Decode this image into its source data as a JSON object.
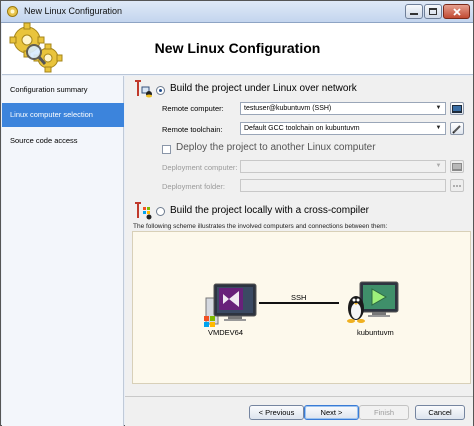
{
  "window": {
    "title": "New Linux Configuration"
  },
  "header": {
    "title": "New Linux Configuration"
  },
  "sidebar": {
    "items": [
      {
        "label": "Configuration summary",
        "selected": false
      },
      {
        "label": "Linux computer selection",
        "selected": true
      },
      {
        "label": "Source code access",
        "selected": false
      }
    ]
  },
  "main": {
    "network_option": {
      "label": "Build the project under Linux over network",
      "checked": true
    },
    "remote_computer": {
      "label": "Remote computer:",
      "value": "testuser@kubuntuvm (SSH)"
    },
    "remote_toolchain": {
      "label": "Remote toolchain:",
      "value": "Default GCC toolchain on kubuntuvm"
    },
    "deploy_option": {
      "label": "Deploy the project to another Linux computer",
      "checked": false
    },
    "deployment_computer": {
      "label": "Deployment computer:",
      "value": ""
    },
    "deployment_folder": {
      "label": "Deployment folder:",
      "value": ""
    },
    "cross_option": {
      "label": "Build the project locally with a cross-compiler",
      "checked": false
    },
    "scheme_description": "The following scheme illustrates the involved computers and connections between them:",
    "scheme": {
      "local_computer": "VMDEV64",
      "remote_computer": "kubuntuvm",
      "connection": "SSH"
    }
  },
  "footer": {
    "previous": "< Previous",
    "next": "Next >",
    "finish": "Finish",
    "cancel": "Cancel"
  },
  "colors": {
    "selection": "#3c84dc",
    "scheme_background": "#fdf9ec",
    "visual_studio_purple": "#68217a"
  }
}
